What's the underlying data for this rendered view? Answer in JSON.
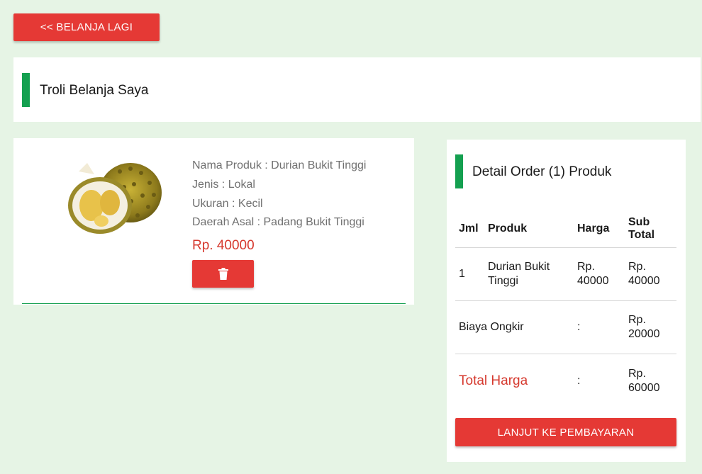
{
  "nav": {
    "back_label": "<< BELANJA LAGI"
  },
  "cart": {
    "title": "Troli Belanja Saya"
  },
  "product": {
    "name_line": "Nama Produk : Durian Bukit Tinggi",
    "type_line": "Jenis : Lokal",
    "size_line": "Ukuran : Kecil",
    "origin_line": "Daerah Asal : Padang Bukit Tinggi",
    "price": "Rp. 40000",
    "image_icon": "durian-fruit-image",
    "delete_icon": "trash-icon"
  },
  "order": {
    "title": "Detail Order (1) Produk",
    "headers": {
      "qty": "Jml",
      "product": "Produk",
      "price": "Harga",
      "subtotal": "Sub Total"
    },
    "items": [
      {
        "qty": "1",
        "product": "Durian Bukit Tinggi",
        "price": "Rp. 40000",
        "subtotal": "Rp. 40000"
      }
    ],
    "shipping": {
      "label": "Biaya Ongkir",
      "sep": ":",
      "value": "Rp. 20000"
    },
    "total": {
      "label": "Total Harga",
      "sep": ":",
      "value": "Rp. 60000"
    },
    "pay_label": "LANJUT KE PEMBAYARAN"
  },
  "colors": {
    "background": "#e6f4e5",
    "accent_green": "#14a050",
    "button_red": "#e53935",
    "price_red": "#d63a2f"
  }
}
